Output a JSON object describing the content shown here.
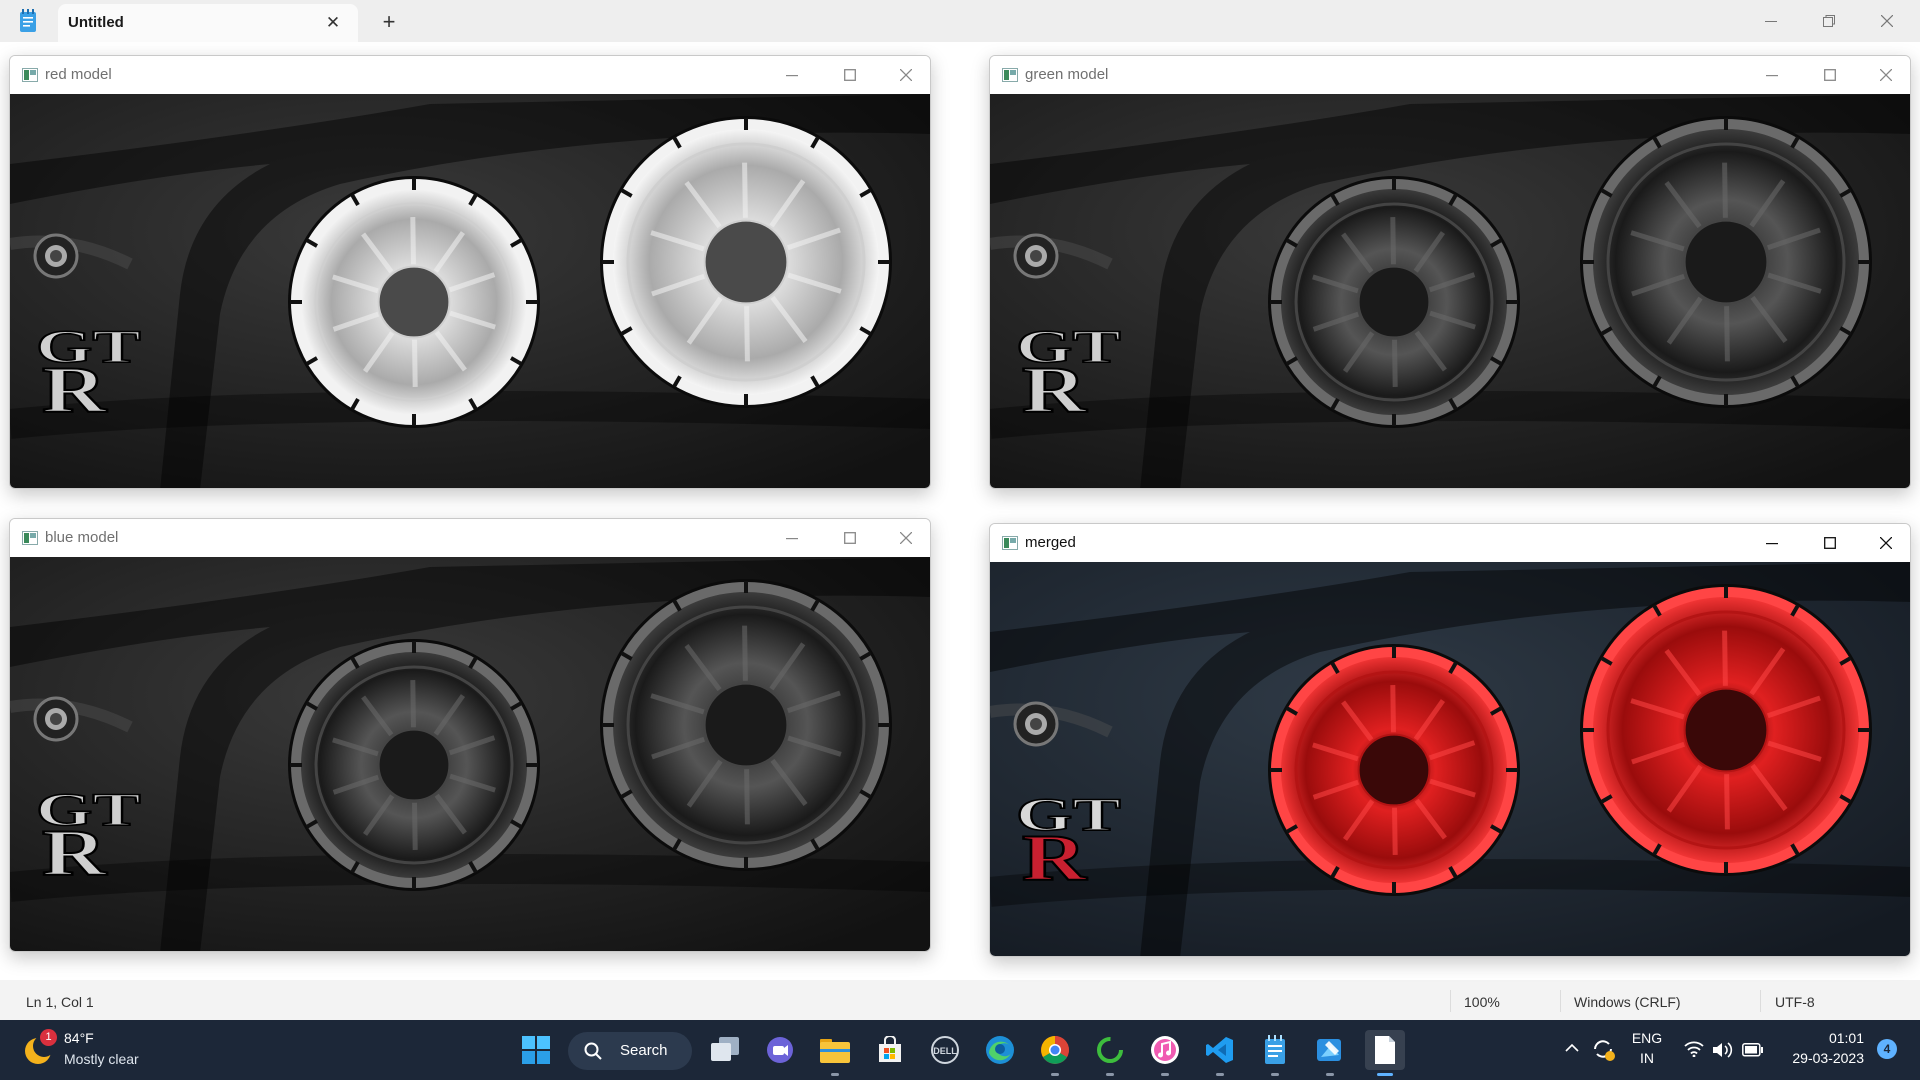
{
  "notepad": {
    "tab_title": "Untitled",
    "status": {
      "position": "Ln 1, Col 1",
      "zoom": "100%",
      "line_ending": "Windows (CRLF)",
      "encoding": "UTF-8"
    }
  },
  "windows": [
    {
      "title": "red model",
      "channel": "red",
      "active": false
    },
    {
      "title": "green model",
      "channel": "green",
      "active": false
    },
    {
      "title": "blue model",
      "channel": "blue",
      "active": false
    },
    {
      "title": "merged",
      "channel": "merged",
      "active": true
    }
  ],
  "taskbar": {
    "weather": {
      "badge": "1",
      "temp": "84°F",
      "condition": "Mostly clear"
    },
    "search_label": "Search",
    "apps": [
      "start-icon",
      "task-view-icon",
      "chat-icon",
      "file-explorer-icon",
      "store-icon",
      "dell-icon",
      "edge-icon",
      "chrome-icon",
      "sync-app-icon",
      "itunes-icon",
      "vscode-icon",
      "notepad-icon",
      "paint-icon",
      "document-icon"
    ],
    "lang": {
      "line1": "ENG",
      "line2": "IN"
    },
    "clock": {
      "time": "01:01",
      "date": "29-03-2023"
    },
    "notifications": "4"
  },
  "colors": {
    "taskbar_bg": "#1c2738",
    "accent": "#5fb2ff",
    "taillight_red": "#ff2a2a"
  }
}
